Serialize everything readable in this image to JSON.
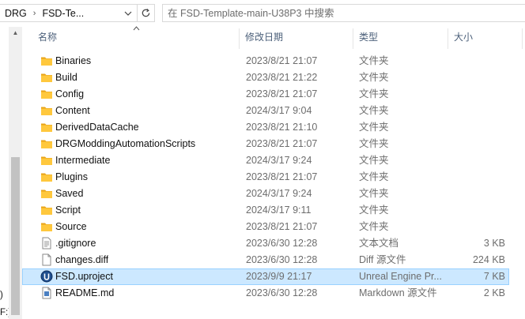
{
  "address_bar": {
    "breadcrumbs": [
      "DRG",
      "FSD-Te..."
    ],
    "search_placeholder": "在 FSD-Template-main-U38P3 中搜索"
  },
  "nav_pane": {
    "fragments": [
      ")",
      "F:)"
    ]
  },
  "columns": {
    "name": "名称",
    "date": "修改日期",
    "type": "类型",
    "size": "大小"
  },
  "files": [
    {
      "name": "Binaries",
      "date": "2023/8/21 21:07",
      "type": "文件夹",
      "size": "",
      "icon": "folder-icon"
    },
    {
      "name": "Build",
      "date": "2023/8/21 21:22",
      "type": "文件夹",
      "size": "",
      "icon": "folder-icon"
    },
    {
      "name": "Config",
      "date": "2023/8/21 21:07",
      "type": "文件夹",
      "size": "",
      "icon": "folder-icon"
    },
    {
      "name": "Content",
      "date": "2024/3/17 9:04",
      "type": "文件夹",
      "size": "",
      "icon": "folder-icon"
    },
    {
      "name": "DerivedDataCache",
      "date": "2023/8/21 21:10",
      "type": "文件夹",
      "size": "",
      "icon": "folder-icon"
    },
    {
      "name": "DRGModdingAutomationScripts",
      "date": "2023/8/21 21:07",
      "type": "文件夹",
      "size": "",
      "icon": "folder-icon"
    },
    {
      "name": "Intermediate",
      "date": "2024/3/17 9:24",
      "type": "文件夹",
      "size": "",
      "icon": "folder-icon"
    },
    {
      "name": "Plugins",
      "date": "2023/8/21 21:07",
      "type": "文件夹",
      "size": "",
      "icon": "folder-icon"
    },
    {
      "name": "Saved",
      "date": "2024/3/17 9:24",
      "type": "文件夹",
      "size": "",
      "icon": "folder-icon"
    },
    {
      "name": "Script",
      "date": "2024/3/17 9:11",
      "type": "文件夹",
      "size": "",
      "icon": "folder-icon"
    },
    {
      "name": "Source",
      "date": "2023/8/21 21:07",
      "type": "文件夹",
      "size": "",
      "icon": "folder-icon"
    },
    {
      "name": ".gitignore",
      "date": "2023/6/30 12:28",
      "type": "文本文档",
      "size": "3 KB",
      "icon": "text-file-icon"
    },
    {
      "name": "changes.diff",
      "date": "2023/6/30 12:28",
      "type": "Diff 源文件",
      "size": "224 KB",
      "icon": "diff-file-icon"
    },
    {
      "name": "FSD.uproject",
      "date": "2023/9/9 21:17",
      "type": "Unreal Engine Pr...",
      "size": "7 KB",
      "icon": "unreal-engine-icon",
      "selected": true
    },
    {
      "name": "README.md",
      "date": "2023/6/30 12:28",
      "type": "Markdown 源文件",
      "size": "2 KB",
      "icon": "markdown-file-icon"
    }
  ],
  "colors": {
    "selection_bg": "#cce8ff",
    "selection_border": "#99d1ff",
    "folder_yellow": "#ffc83d",
    "header_text": "#4c607a"
  }
}
